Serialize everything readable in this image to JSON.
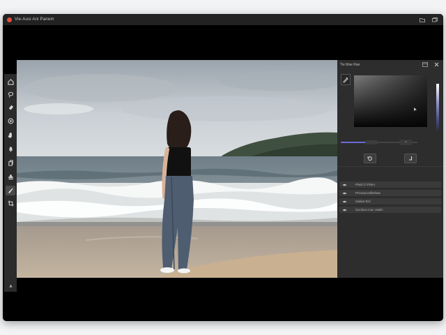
{
  "window": {
    "title": "Vie-Ausi Ani Panem"
  },
  "canvas": {
    "image_alt": "Woman standing on a beach facing the sea"
  },
  "toolbar": {
    "tools": [
      {
        "name": "move-tool",
        "icon": "home-icon"
      },
      {
        "name": "lasso-tool",
        "icon": "lasso-icon"
      },
      {
        "name": "eraser-tool",
        "icon": "eraser-icon"
      },
      {
        "name": "dodge-tool",
        "icon": "dodge-icon"
      },
      {
        "name": "hand-tool",
        "icon": "hand-icon"
      },
      {
        "name": "bell-tool",
        "icon": "bell-icon"
      },
      {
        "name": "clone-tool",
        "icon": "clone-icon"
      },
      {
        "name": "stamp-tool",
        "icon": "stamp-icon"
      },
      {
        "name": "brush-tool",
        "icon": "brush-icon",
        "active": true
      },
      {
        "name": "crop-tool",
        "icon": "crop-icon"
      }
    ]
  },
  "panel": {
    "title": "Tie Mae Rae",
    "slider_value": 0.32,
    "slider_button": "·•",
    "layers": [
      {
        "label": "Plaid Cl Fletro"
      },
      {
        "label": "Privoauocdlinrbae"
      },
      {
        "label": "Sialwe Eicl"
      },
      {
        "label": "Sociluvo Icun Jaelis"
      }
    ]
  },
  "colors": {
    "accent": "#6c6cd8",
    "panel_bg": "#2d2d2d",
    "toolbar_bg": "#2b2b2b",
    "app_icon": "#e0503e"
  }
}
